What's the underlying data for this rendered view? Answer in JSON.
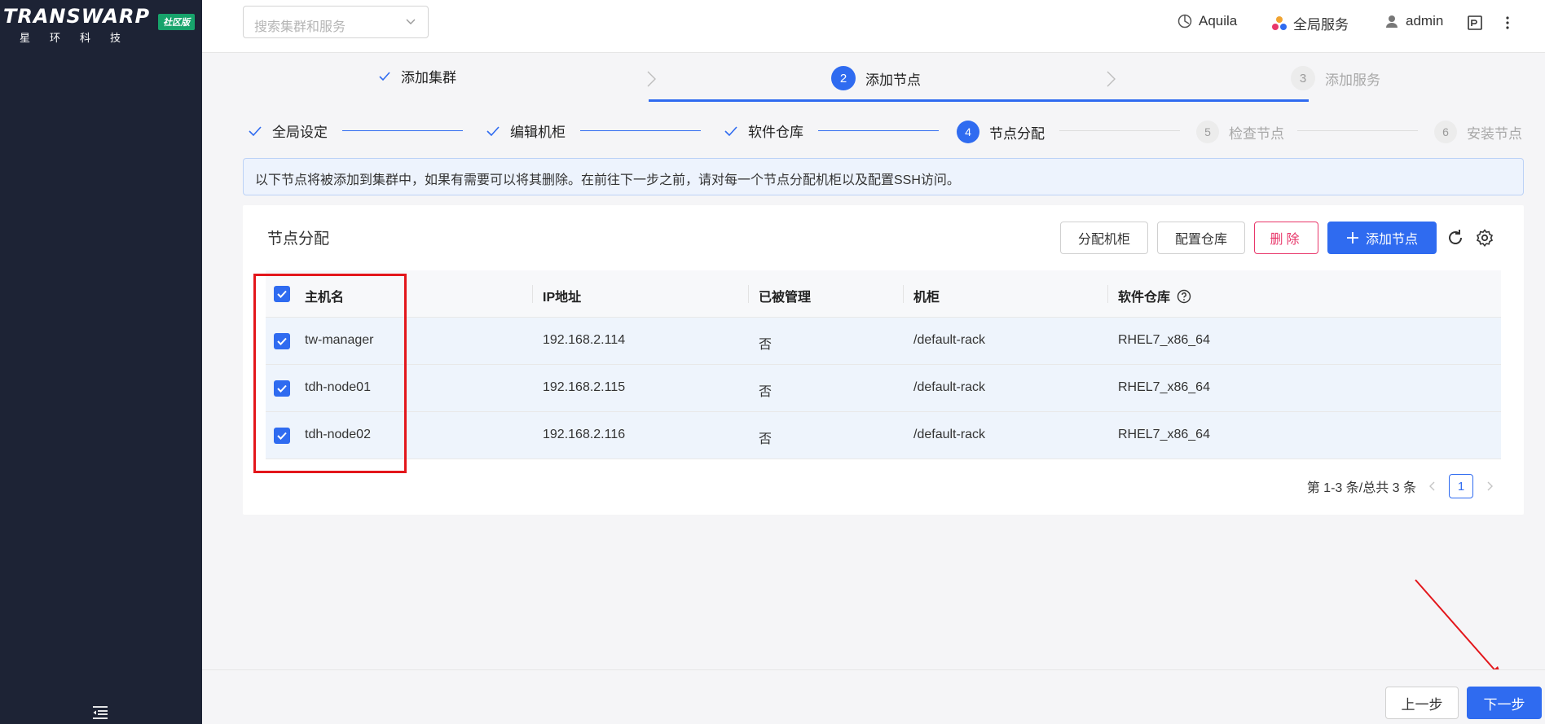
{
  "brand": {
    "logo_text": "TRANSWARP",
    "badge": "社区版",
    "subtitle": "星环科技"
  },
  "topbar": {
    "search_placeholder": "搜索集群和服务",
    "nav": {
      "cluster": "Aquila",
      "global_services": "全局服务",
      "user": "admin"
    }
  },
  "main_steps": [
    {
      "label": "添加集群",
      "state": "done"
    },
    {
      "num": "2",
      "label": "添加节点",
      "state": "active"
    },
    {
      "num": "3",
      "label": "添加服务",
      "state": "wait"
    }
  ],
  "sub_steps": [
    {
      "label": "全局设定",
      "state": "done"
    },
    {
      "label": "编辑机柜",
      "state": "done"
    },
    {
      "label": "软件仓库",
      "state": "done"
    },
    {
      "num": "4",
      "label": "节点分配",
      "state": "active"
    },
    {
      "num": "5",
      "label": "检查节点",
      "state": "wait"
    },
    {
      "num": "6",
      "label": "安装节点",
      "state": "wait"
    }
  ],
  "alert": "以下节点将被添加到集群中，如果有需要可以将其删除。在前往下一步之前，请对每一个节点分配机柜以及配置SSH访问。",
  "card": {
    "title": "节点分配",
    "buttons": {
      "assign_rack": "分配机柜",
      "config_repo": "配置仓库",
      "delete": "删除",
      "add_node": "添加节点"
    }
  },
  "table": {
    "columns": [
      "主机名",
      "IP地址",
      "已被管理",
      "机柜",
      "软件仓库"
    ],
    "rows": [
      {
        "hostname": "tw-manager",
        "ip": "192.168.2.114",
        "managed": "否",
        "rack": "/default-rack",
        "repo": "RHEL7_x86_64",
        "checked": true
      },
      {
        "hostname": "tdh-node01",
        "ip": "192.168.2.115",
        "managed": "否",
        "rack": "/default-rack",
        "repo": "RHEL7_x86_64",
        "checked": true
      },
      {
        "hostname": "tdh-node02",
        "ip": "192.168.2.116",
        "managed": "否",
        "rack": "/default-rack",
        "repo": "RHEL7_x86_64",
        "checked": true
      }
    ],
    "select_all_checked": true
  },
  "pagination": {
    "summary": "第 1-3 条/总共 3 条",
    "current_page": "1"
  },
  "footer": {
    "prev": "上一步",
    "next": "下一步"
  },
  "colors": {
    "primary": "#2f6bf0",
    "danger": "#e8376a",
    "sidebar": "#1d2335",
    "annotation": "#e3161b"
  },
  "icons": [
    "search-chevron-icon",
    "cluster-icon",
    "services-icon",
    "user-icon",
    "logout-icon",
    "more-icon",
    "check-icon",
    "chevron-right-icon",
    "plus-icon",
    "refresh-icon",
    "settings-icon",
    "help-icon",
    "menu-collapse-icon"
  ]
}
